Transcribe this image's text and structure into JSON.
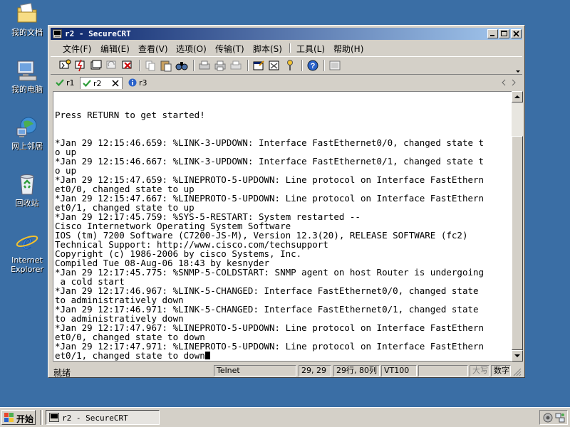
{
  "desktop": {
    "icons": [
      {
        "label": "我的文档",
        "icon": "my-documents-icon"
      },
      {
        "label": "我的电脑",
        "icon": "my-computer-icon"
      },
      {
        "label": "网上邻居",
        "icon": "network-places-icon"
      },
      {
        "label": "回收站",
        "icon": "recycle-bin-icon"
      },
      {
        "label": "Internet Explorer",
        "icon": "internet-explorer-icon"
      }
    ]
  },
  "window": {
    "title": "r2 - SecureCRT",
    "menu": [
      "文件(F)",
      "编辑(E)",
      "查看(V)",
      "选项(O)",
      "传输(T)",
      "脚本(S)",
      "工具(L)",
      "帮助(H)"
    ],
    "tabs": [
      {
        "label": "r1",
        "status": "connected"
      },
      {
        "label": "r2",
        "status": "connected",
        "active": true
      },
      {
        "label": "r3",
        "status": "info"
      }
    ],
    "toolbar_icons": [
      "connect-icon",
      "quick-connect-icon",
      "connect-tab-icon",
      "reconnect-icon",
      "disconnect-icon",
      "copy-icon",
      "paste-icon",
      "find-icon",
      "print-setup-icon",
      "print-selection-icon",
      "print-icon",
      "session-options-icon",
      "global-options-icon",
      "keymap-icon",
      "help-icon",
      "sftp-icon"
    ]
  },
  "terminal": {
    "lines": [
      "",
      "",
      "Press RETURN to get started!",
      "",
      "",
      "*Jan 29 12:15:46.659: %LINK-3-UPDOWN: Interface FastEthernet0/0, changed state t",
      "o up",
      "*Jan 29 12:15:46.667: %LINK-3-UPDOWN: Interface FastEthernet0/1, changed state t",
      "o up",
      "*Jan 29 12:15:47.659: %LINEPROTO-5-UPDOWN: Line protocol on Interface FastEthern",
      "et0/0, changed state to up",
      "*Jan 29 12:15:47.667: %LINEPROTO-5-UPDOWN: Line protocol on Interface FastEthern",
      "et0/1, changed state to up",
      "*Jan 29 12:17:45.759: %SYS-5-RESTART: System restarted --",
      "Cisco Internetwork Operating System Software",
      "IOS (tm) 7200 Software (C7200-JS-M), Version 12.3(20), RELEASE SOFTWARE (fc2)",
      "Technical Support: http://www.cisco.com/techsupport",
      "Copyright (c) 1986-2006 by cisco Systems, Inc.",
      "Compiled Tue 08-Aug-06 18:43 by kesnyder",
      "*Jan 29 12:17:45.775: %SNMP-5-COLDSTART: SNMP agent on host Router is undergoing",
      " a cold start",
      "*Jan 29 12:17:46.967: %LINK-5-CHANGED: Interface FastEthernet0/0, changed state",
      "to administratively down",
      "*Jan 29 12:17:46.971: %LINK-5-CHANGED: Interface FastEthernet0/1, changed state",
      "to administratively down",
      "*Jan 29 12:17:47.967: %LINEPROTO-5-UPDOWN: Line protocol on Interface FastEthern",
      "et0/0, changed state to down",
      "*Jan 29 12:17:47.971: %LINEPROTO-5-UPDOWN: Line protocol on Interface FastEthern",
      "et0/1, changed state to down"
    ]
  },
  "status": {
    "ready": "就绪",
    "protocol": "Telnet",
    "cursor_pos": "29, 29",
    "size": "29行, 80列",
    "emulation": "VT100",
    "caps": "大写",
    "num": "数字"
  },
  "taskbar": {
    "start": "开始",
    "task": "r2 - SecureCRT"
  },
  "colors": {
    "desktop": "#3a6ea5",
    "title_start": "#0a246a",
    "title_end": "#a6caf0",
    "face": "#d4d0c8"
  }
}
